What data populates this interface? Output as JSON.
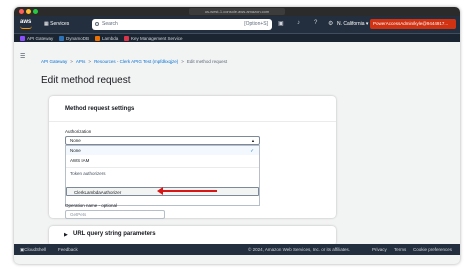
{
  "browser": {
    "url": "us-west-1.console.aws.amazon.com"
  },
  "topnav": {
    "logo": "aws",
    "services_label": "Services",
    "search_placeholder": "Search",
    "search_shortcut": "[Option+S]",
    "region": "N. California",
    "account": "PowerAccessAdmin/kyle@9444917..."
  },
  "favorites": [
    {
      "label": "API Gateway",
      "color": "#8c4fff"
    },
    {
      "label": "DynamoDB",
      "color": "#2e73b8"
    },
    {
      "label": "Lambda",
      "color": "#ed7100"
    },
    {
      "label": "Key Management Service",
      "color": "#dd344c"
    }
  ],
  "breadcrumb": {
    "items": [
      "API Gateway",
      "APIs",
      "Resources - Clerk APIG Test (mpfdkxqjze)"
    ],
    "current": "Edit method request"
  },
  "page_title": "Edit method request",
  "settings": {
    "title": "Method request settings",
    "authorization_label": "Authorization",
    "authorization_value": "None",
    "options": [
      {
        "label": "None",
        "selected": true
      },
      {
        "label": "AWS IAM",
        "selected": false
      }
    ],
    "group_label": "Token authorizers",
    "highlighted_option": "ClerkLambdaAuthorizer",
    "operation_name_label": "Operation name - optional",
    "operation_name_placeholder": "GetPets"
  },
  "url_query_section": "URL query string parameters",
  "footer": {
    "cloudshell": "CloudShell",
    "feedback": "Feedback",
    "copyright": "© 2024, Amazon Web Services, Inc. or its affiliates.",
    "privacy": "Privacy",
    "terms": "Terms",
    "cookies": "Cookie preferences"
  }
}
